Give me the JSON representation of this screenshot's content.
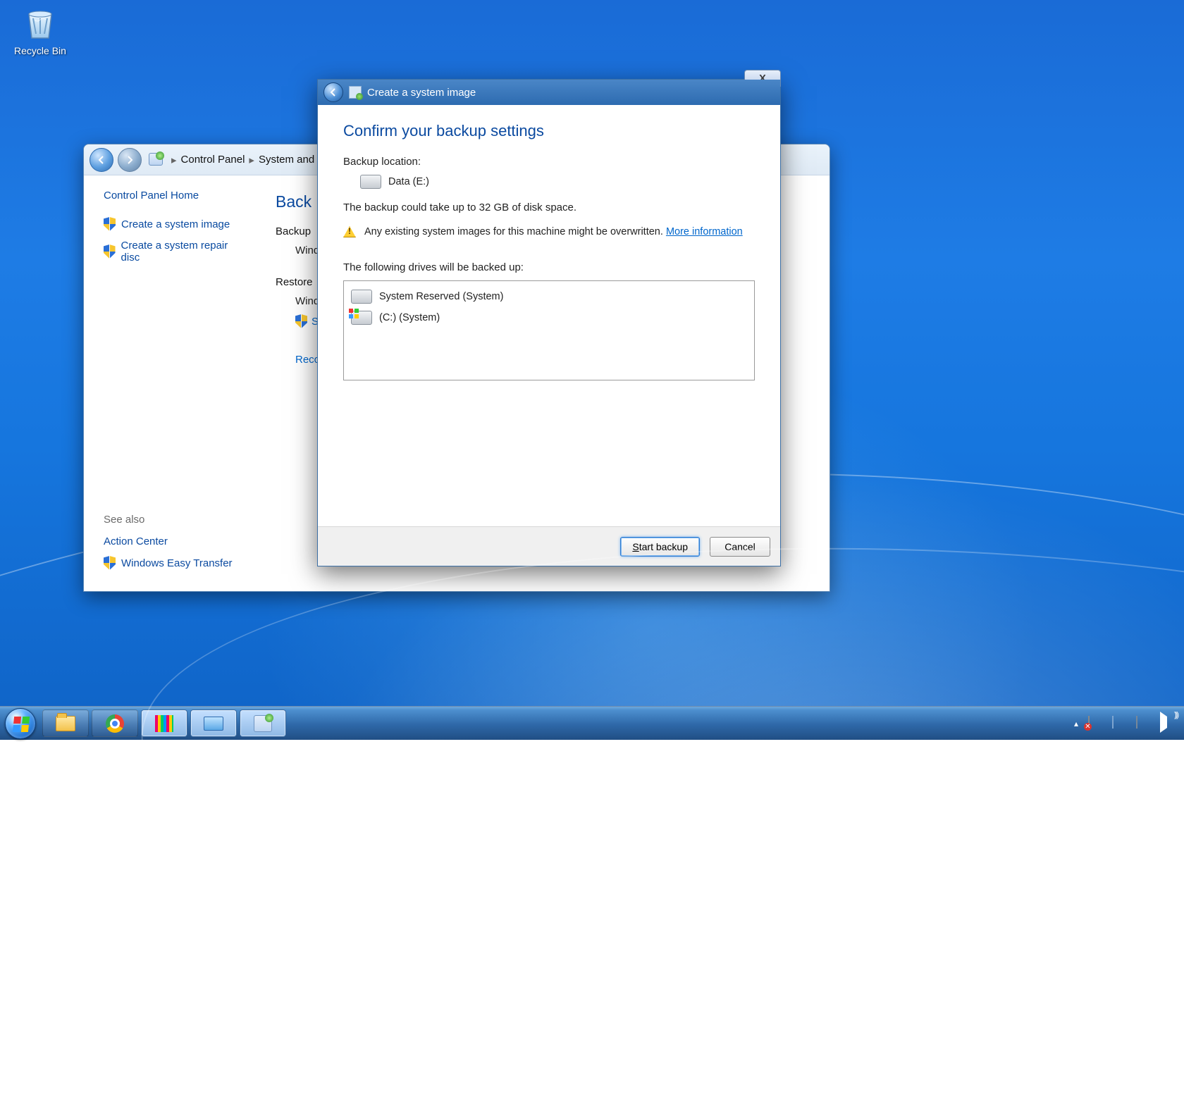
{
  "desktop": {
    "recycle_bin_label": "Recycle Bin"
  },
  "cpl": {
    "breadcrumb": {
      "root": "Control Panel",
      "sub": "System and Se"
    },
    "home": "Control Panel Home",
    "side_links": {
      "create_image": "Create a system image",
      "create_repair": "Create a system repair disc"
    },
    "main": {
      "heading": "Back up",
      "section_backup": "Backup",
      "backup_sub": "Windo",
      "section_restore": "Restore",
      "restore_sub": "Windo",
      "sel_link": "Sel",
      "recov_link": "Recov"
    },
    "see_also": {
      "header": "See also",
      "action_center": "Action Center",
      "easy_transfer": "Windows Easy Transfer"
    }
  },
  "wizard": {
    "title": "Create a system image",
    "close_glyph": "X",
    "heading": "Confirm your backup settings",
    "backup_location_label": "Backup location:",
    "backup_location_value": "Data (E:)",
    "size_estimate": "The backup could take up to 32 GB of disk space.",
    "overwrite_warning": "Any existing system images for this machine might be overwritten.",
    "more_info": "More information",
    "drives_label": "The following drives will be backed up:",
    "drives": {
      "0": "System Reserved (System)",
      "1": "(C:) (System)"
    },
    "buttons": {
      "start": "Start backup",
      "start_underline_char": "S",
      "cancel": "Cancel"
    }
  }
}
